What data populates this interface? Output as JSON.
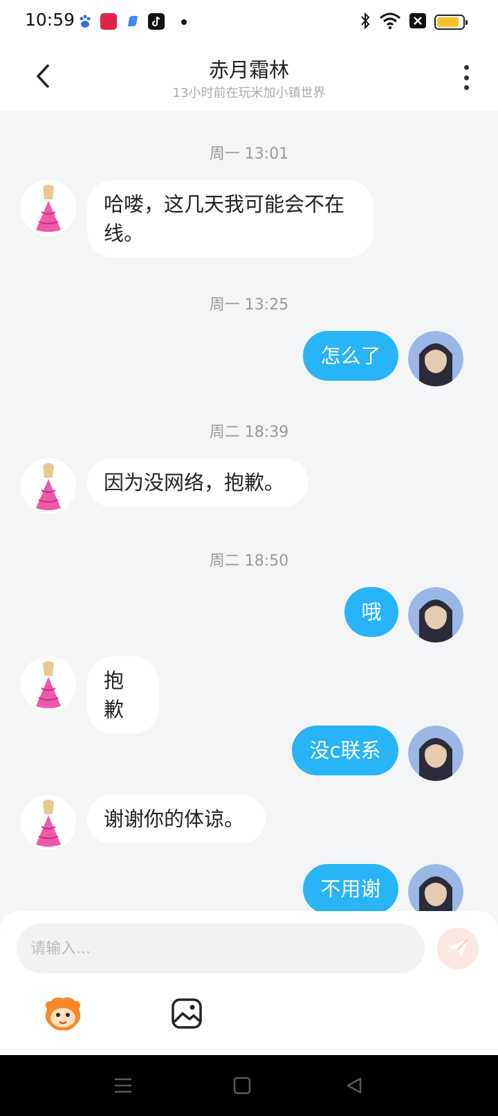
{
  "status_bar": {
    "time": "10:59",
    "app_icons": [
      "baidu-icon",
      "taobao-live-icon",
      "blue-app-icon",
      "tiktok-icon"
    ],
    "battery_level": 0.85
  },
  "header": {
    "title": "赤月霜林",
    "subtitle": "13小时前在玩米加小镇世界"
  },
  "chat": {
    "items": [
      {
        "type": "timestamp",
        "text": "周一 13:01"
      },
      {
        "type": "incoming",
        "text": "哈喽，这几天我可能会不在线。"
      },
      {
        "type": "timestamp",
        "text": "周一 13:25"
      },
      {
        "type": "outgoing",
        "text": "怎么了"
      },
      {
        "type": "timestamp",
        "text": "周二 18:39"
      },
      {
        "type": "incoming",
        "text": "因为没网络，抱歉。"
      },
      {
        "type": "timestamp",
        "text": "周二 18:50"
      },
      {
        "type": "outgoing",
        "text": "哦"
      },
      {
        "type": "incoming",
        "text": "抱歉"
      },
      {
        "type": "outgoing",
        "text": "没c联系"
      },
      {
        "type": "incoming",
        "text": "谢谢你的体谅。"
      },
      {
        "type": "outgoing",
        "text": "不用谢"
      }
    ]
  },
  "input": {
    "placeholder": "请输入..."
  },
  "toolbar": {
    "icons": [
      "emoji-mascot-icon",
      "image-icon"
    ]
  },
  "colors": {
    "outgoing_bubble": "#28b4f7",
    "incoming_bubble": "#ffffff",
    "background": "#f4f5f7",
    "send_button_bg": "#fde7e3"
  }
}
